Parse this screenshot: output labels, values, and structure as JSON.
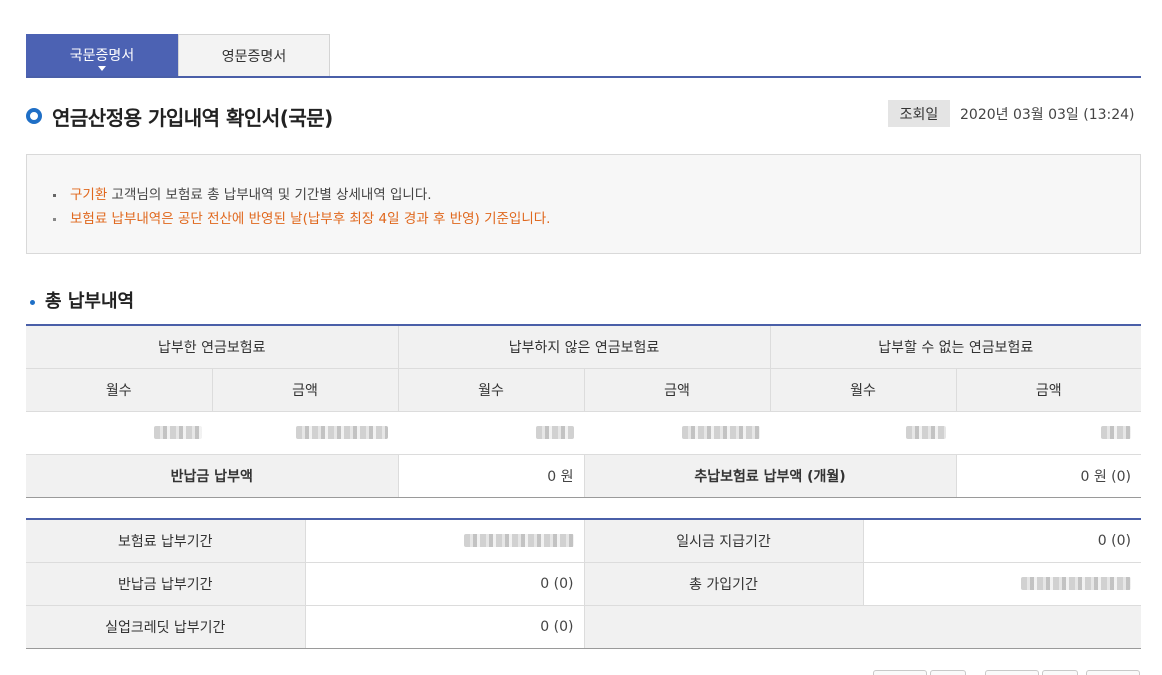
{
  "tabs": [
    {
      "label": "국문증명서",
      "active": true
    },
    {
      "label": "영문증명서",
      "active": false
    }
  ],
  "title": "연금산정용 가입내역 확인서(국문)",
  "inquiry": {
    "label": "조회일",
    "value": "2020년 03월 03일 (13:24)"
  },
  "notice": {
    "customer_name": "구기환",
    "line1_rest": " 고객님의 보험료 총 납부내역 및 기간별 상세내역 입니다.",
    "line2": "보험료 납부내역은 공단 전산에 반영된 날(납부후 최장 4일 경과 후 반영) 기준입니다."
  },
  "section_title": "총 납부내역",
  "total_table": {
    "groups": [
      "납부한 연금보험료",
      "납부하지 않은 연금보험료",
      "납부할 수 없는 연금보험료"
    ],
    "sub_months": "월수",
    "sub_amount": "금액",
    "refund_label": "반납금 납부액",
    "refund_value": "0 원",
    "additional_label": "추납보험료 납부액 (개월)",
    "additional_value": "0 원 (0)"
  },
  "period_table": {
    "premium_period_label": "보험료 납부기간",
    "lump_sum_label": "일시금 지급기간",
    "lump_sum_value": "0 (0)",
    "refund_period_label": "반납금 납부기간",
    "refund_period_value": "0 (0)",
    "total_period_label": "총 가입기간",
    "unemployment_label": "실업크레딧 납부기간",
    "unemployment_value": "0 (0)"
  },
  "colors": {
    "accent_blue": "#4c62b3",
    "accent_orange": "#e0681e",
    "bullet_blue": "#1f6fc6"
  }
}
